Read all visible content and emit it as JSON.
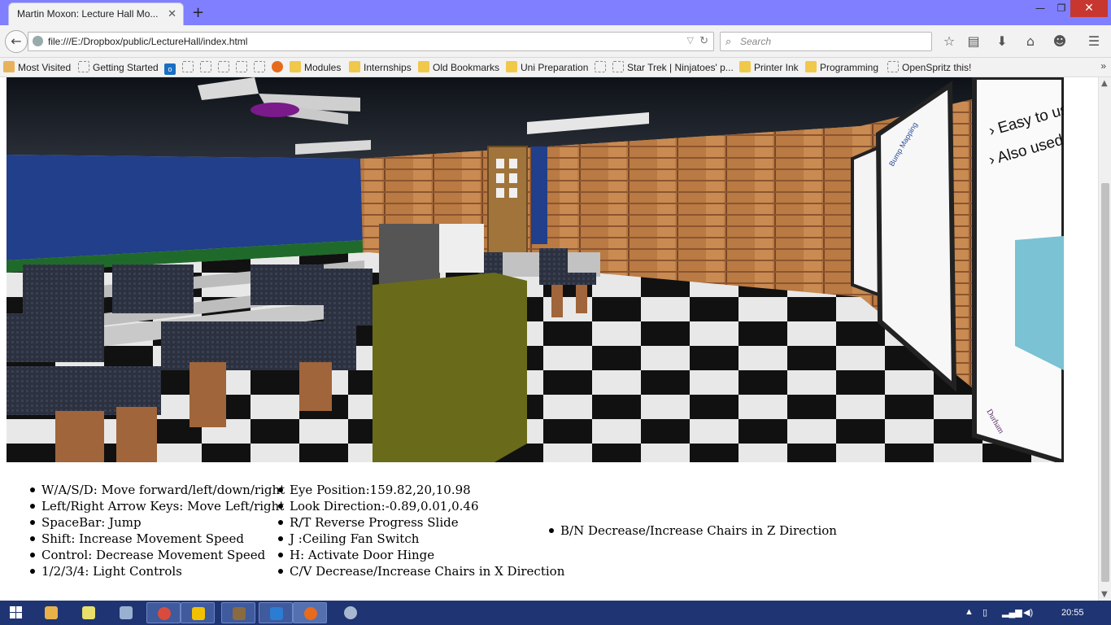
{
  "browser": {
    "tab_title": "Martin Moxon: Lecture Hall Mo...",
    "new_tab_icon": "plus-icon",
    "window_controls": [
      "minimize",
      "maximize",
      "close"
    ],
    "url": "file:///E:/Dropbox/public/LectureHall/index.html",
    "search_placeholder": "Search",
    "toolbar_icons": [
      "star-icon",
      "reading-list-icon",
      "download-icon",
      "home-icon",
      "emoji-icon",
      "menu-icon"
    ]
  },
  "bookmarks": [
    {
      "label": "Most Visited",
      "icon": "bookmark-icon"
    },
    {
      "label": "Getting Started",
      "icon": "blank-page-icon"
    },
    {
      "label": "",
      "icon": "outlook-icon"
    },
    {
      "label": "",
      "icon": "blank-page-icon"
    },
    {
      "label": "",
      "icon": "blank-page-icon"
    },
    {
      "label": "",
      "icon": "blank-page-icon"
    },
    {
      "label": "",
      "icon": "blank-page-icon"
    },
    {
      "label": "",
      "icon": "blank-page-icon"
    },
    {
      "label": "",
      "icon": "fire-icon"
    },
    {
      "label": "Modules",
      "icon": "folder-icon"
    },
    {
      "label": "Internships",
      "icon": "folder-icon"
    },
    {
      "label": "Old Bookmarks",
      "icon": "folder-icon"
    },
    {
      "label": "Uni Preparation",
      "icon": "folder-icon"
    },
    {
      "label": "",
      "icon": "blank-page-icon"
    },
    {
      "label": "Star Trek | Ninjatoes' p...",
      "icon": "blank-page-icon"
    },
    {
      "label": "Printer Ink",
      "icon": "folder-icon"
    },
    {
      "label": "Programming",
      "icon": "folder-icon"
    },
    {
      "label": "OpenSpritz this!",
      "icon": "blank-page-icon"
    }
  ],
  "controls": {
    "column1": [
      "W/A/S/D: Move forward/left/down/right",
      "Left/Right Arrow Keys: Move Left/right",
      "SpaceBar: Jump",
      "Shift: Increase Movement Speed",
      "Control: Decrease Movement Speed",
      "1/2/3/4: Light Controls"
    ],
    "column2": [
      "Eye Position:159.82,20,10.98",
      "Look Direction:-0.89,0.01,0.46",
      "R/T Reverse Progress Slide",
      "J :Ceiling Fan Switch",
      "H: Activate Door Hinge",
      "C/V Decrease/Increase Chairs in X Direction"
    ],
    "column3": [
      "B/N Decrease/Increase Chairs in Z Direction"
    ]
  },
  "slides": {
    "far_title": "Bump Mapping",
    "near_bullets": [
      "Easy to use w",
      "Also used in e"
    ],
    "logo": "Durham"
  },
  "taskbar": {
    "apps": [
      "file-explorer-icon",
      "notepad-icon",
      "remote-desktop-icon",
      "chrome-icon",
      "chat-icon",
      "media-icon",
      "word-icon",
      "firefox-icon",
      "tool-icon"
    ],
    "active_app": "firefox-icon",
    "clock": "20:55"
  }
}
